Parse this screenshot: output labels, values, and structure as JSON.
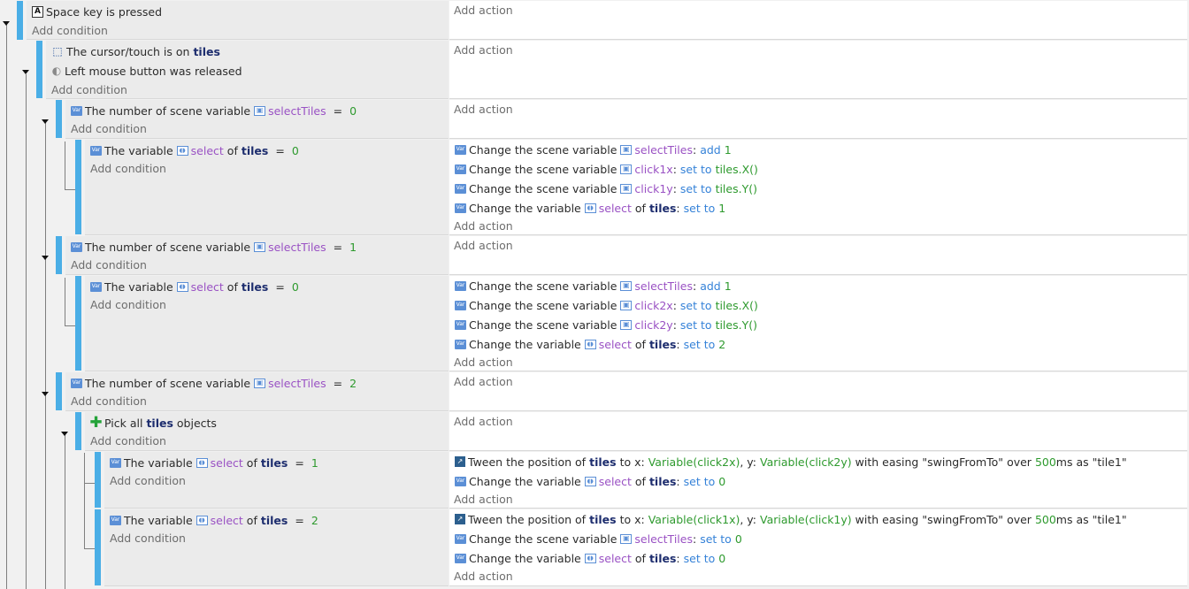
{
  "events": {
    "e1": {
      "cond1": "Space key is pressed",
      "add_condition": "Add condition",
      "add_action": "Add action"
    },
    "e2": {
      "cond1_prefix": "The cursor/touch is on",
      "cond1_obj": "tiles",
      "cond2": "Left mouse button was released",
      "add_condition": "Add condition",
      "add_action": "Add action"
    },
    "e3": {
      "prefix": "The number of scene variable",
      "var": "selectTiles",
      "op": "=",
      "val": "0",
      "add_condition": "Add condition",
      "add_action": "Add action"
    },
    "e4": {
      "prefix": "The variable",
      "var": "select",
      "of": "of",
      "obj": "tiles",
      "op": "=",
      "val": "0",
      "add_condition": "Add condition",
      "add_action": "Add action",
      "actions": [
        {
          "prefix": "Change the scene variable",
          "var": "selectTiles",
          "colon": ":",
          "op": "add",
          "val": "1"
        },
        {
          "prefix": "Change the scene variable",
          "var": "click1x",
          "colon": ":",
          "op": "set to",
          "val": "tiles.X()"
        },
        {
          "prefix": "Change the scene variable",
          "var": "click1y",
          "colon": ":",
          "op": "set to",
          "val": "tiles.Y()"
        },
        {
          "prefix": "Change the variable",
          "var": "select",
          "of": "of",
          "obj": "tiles",
          "colon": ":",
          "op": "set to",
          "val": "1"
        }
      ]
    },
    "e5": {
      "prefix": "The number of scene variable",
      "var": "selectTiles",
      "op": "=",
      "val": "1",
      "add_condition": "Add condition",
      "add_action": "Add action"
    },
    "e6": {
      "prefix": "The variable",
      "var": "select",
      "of": "of",
      "obj": "tiles",
      "op": "=",
      "val": "0",
      "add_condition": "Add condition",
      "add_action": "Add action",
      "actions": [
        {
          "prefix": "Change the scene variable",
          "var": "selectTiles",
          "colon": ":",
          "op": "add",
          "val": "1"
        },
        {
          "prefix": "Change the scene variable",
          "var": "click2x",
          "colon": ":",
          "op": "set to",
          "val": "tiles.X()"
        },
        {
          "prefix": "Change the scene variable",
          "var": "click2y",
          "colon": ":",
          "op": "set to",
          "val": "tiles.Y()"
        },
        {
          "prefix": "Change the variable",
          "var": "select",
          "of": "of",
          "obj": "tiles",
          "colon": ":",
          "op": "set to",
          "val": "2"
        }
      ]
    },
    "e7": {
      "prefix": "The number of scene variable",
      "var": "selectTiles",
      "op": "=",
      "val": "2",
      "add_condition": "Add condition",
      "add_action": "Add action"
    },
    "e8": {
      "prefix": "Pick all",
      "obj": "tiles",
      "suffix": "objects",
      "add_condition": "Add condition",
      "add_action": "Add action"
    },
    "e9": {
      "prefix": "The variable",
      "var": "select",
      "of": "of",
      "obj": "tiles",
      "op": "=",
      "val": "1",
      "add_condition": "Add condition",
      "add_action": "Add action",
      "tween": {
        "prefix": "Tween the position of",
        "obj": "tiles",
        "to_x": "to x:",
        "x": "Variable(click2x)",
        "y_lbl": ", y:",
        "y": "Variable(click2y)",
        "with": "with easing",
        "easing": "\"swingFromTo\"",
        "over": "over",
        "ms_val": "500",
        "ms_as": "ms as",
        "name": "\"tile1\""
      },
      "action2": {
        "prefix": "Change the variable",
        "var": "select",
        "of": "of",
        "obj": "tiles",
        "colon": ":",
        "op": "set to",
        "val": "0"
      }
    },
    "e10": {
      "prefix": "The variable",
      "var": "select",
      "of": "of",
      "obj": "tiles",
      "op": "=",
      "val": "2",
      "add_condition": "Add condition",
      "add_action": "Add action",
      "tween": {
        "prefix": "Tween the position of",
        "obj": "tiles",
        "to_x": "to x:",
        "x": "Variable(click1x)",
        "y_lbl": ", y:",
        "y": "Variable(click1y)",
        "with": "with easing",
        "easing": "\"swingFromTo\"",
        "over": "over",
        "ms_val": "500",
        "ms_as": "ms as",
        "name": "\"tile1\""
      },
      "action2": {
        "prefix": "Change the scene variable",
        "var": "selectTiles",
        "colon": ":",
        "op": "set to",
        "val": "0"
      },
      "action3": {
        "prefix": "Change the variable",
        "var": "select",
        "of": "of",
        "obj": "tiles",
        "colon": ":",
        "op": "set to",
        "val": "0"
      }
    }
  },
  "icons": {
    "key": "keyboard-key-icon",
    "cursor": "cursor-on-object-icon",
    "mouse": "mouse-icon",
    "var": "variable-icon",
    "scene_var": "scene-variable-icon",
    "obj_var": "object-variable-icon",
    "plus": "pick-all-plus-icon",
    "tween": "tween-icon"
  },
  "colors": {
    "accent_bar": "#4aaee6",
    "object": "#1d2d6e",
    "variable": "#9a52c4",
    "operator": "#3582d8",
    "value": "#2e9a2e"
  }
}
